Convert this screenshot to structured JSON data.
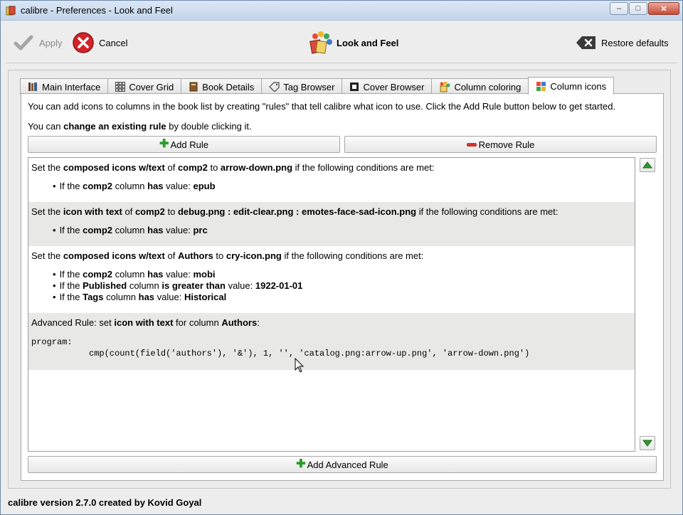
{
  "window": {
    "title": "calibre - Preferences - Look and Feel",
    "minimize": "–",
    "maximize": "□",
    "close": "✕"
  },
  "toolbar": {
    "apply": "Apply",
    "cancel": "Cancel",
    "section": "Look and Feel",
    "restore": "Restore defaults"
  },
  "tabs": [
    "Main Interface",
    "Cover Grid",
    "Book Details",
    "Tag Browser",
    "Cover Browser",
    "Column coloring",
    "Column icons"
  ],
  "panel": {
    "intro1": "You can add icons to columns in the book list by creating \"rules\" that tell calibre what icon to use. Click the Add Rule button below to get started.",
    "intro2_pre": "You can ",
    "intro2_bold": "change an existing rule",
    "intro2_post": " by double clicking it.",
    "add_rule": "Add Rule",
    "remove_rule": "Remove Rule",
    "add_advanced_rule": "Add Advanced Rule"
  },
  "rules": {
    "r1": {
      "pre": "Set the ",
      "kind": "composed icons w/text",
      "of": " of ",
      "col": "comp2",
      "to": " to ",
      "icon": "arrow-down.png",
      "post": " if the following conditions are met:",
      "c1": {
        "pre": "If the ",
        "col": "comp2",
        "mid": " column ",
        "op": "has",
        "vpre": " value: ",
        "val": "epub"
      }
    },
    "r2": {
      "pre": "Set the ",
      "kind": "icon with text",
      "of": " of ",
      "col": "comp2",
      "to": " to ",
      "icon": "debug.png : edit-clear.png : emotes-face-sad-icon.png",
      "post": " if the following conditions are met:",
      "c1": {
        "pre": "If the ",
        "col": "comp2",
        "mid": " column ",
        "op": "has",
        "vpre": " value: ",
        "val": "prc"
      }
    },
    "r3": {
      "pre": "Set the ",
      "kind": "composed icons w/text",
      "of": " of ",
      "col": "Authors",
      "to": " to ",
      "icon": "cry-icon.png",
      "post": " if the following conditions are met:",
      "c1": {
        "pre": "If the ",
        "col": "comp2",
        "mid": " column ",
        "op": "has",
        "vpre": " value: ",
        "val": "mobi"
      },
      "c2": {
        "pre": "If the ",
        "col": "Published",
        "mid": " column ",
        "op": "is greater than",
        "vpre": " value: ",
        "val": "1922-01-01"
      },
      "c3": {
        "pre": "If the ",
        "col": "Tags",
        "mid": " column ",
        "op": "has",
        "vpre": " value: ",
        "val": "Historical"
      }
    },
    "r4": {
      "pre": "Advanced Rule: set ",
      "kind": "icon with text",
      "mid": " for column ",
      "col": "Authors",
      "post": ":",
      "line1": "program:",
      "line2": "cmp(count(field('authors'), '&'), 1, '', 'catalog.png:arrow-up.png', 'arrow-down.png')"
    }
  },
  "status": "calibre version 2.7.0 created by Kovid Goyal"
}
